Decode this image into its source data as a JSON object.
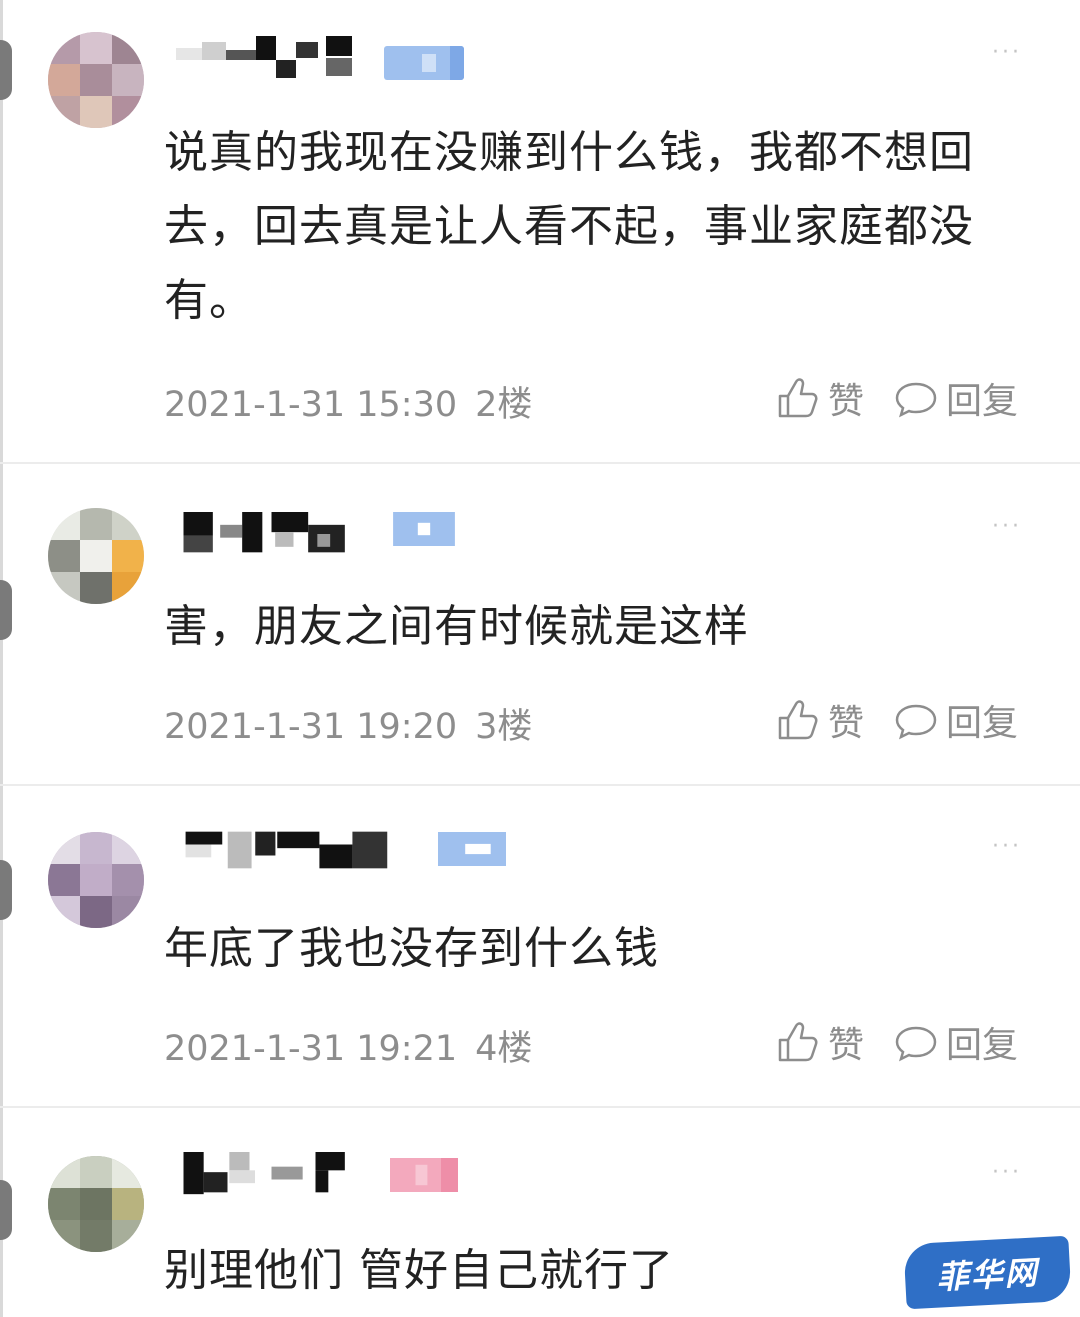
{
  "comments": [
    {
      "text": "说真的我现在没赚到什么钱，我都不想回去，回去真是让人看不起，事业家庭都没有。",
      "date": "2021-1-31 15:30",
      "floor": "2楼",
      "like_label": "赞",
      "reply_label": "回复",
      "more": "···"
    },
    {
      "text": "害，朋友之间有时候就是这样",
      "date": "2021-1-31 19:20",
      "floor": "3楼",
      "like_label": "赞",
      "reply_label": "回复",
      "more": "···"
    },
    {
      "text": "年底了我也没存到什么钱",
      "date": "2021-1-31 19:21",
      "floor": "4楼",
      "like_label": "赞",
      "reply_label": "回复",
      "more": "···"
    },
    {
      "text": "别理他们 管好自己就行了",
      "more": "···"
    }
  ],
  "watermark": "菲华网",
  "colors": {
    "text": "#222222",
    "meta": "#8d8d8d",
    "divider": "#ececec",
    "badge_blue": "#9fc0ee",
    "badge_pink": "#f3a9bd",
    "watermark_bg": "#2f6fc6"
  }
}
